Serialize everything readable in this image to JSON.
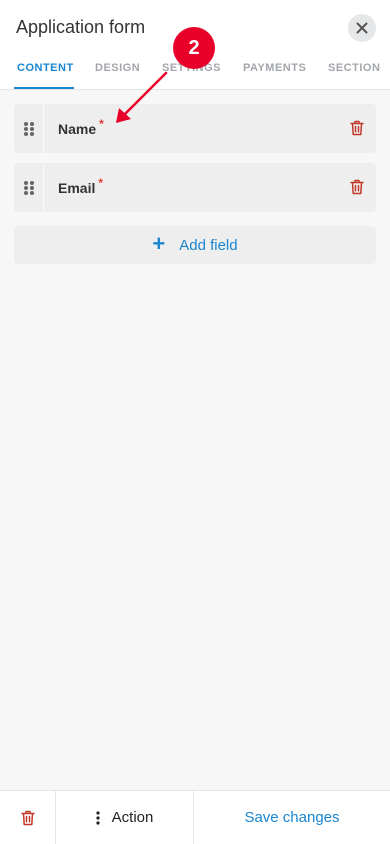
{
  "header": {
    "title": "Application form",
    "close_icon": "close-icon"
  },
  "tabs": [
    {
      "label": "CONTENT",
      "active": true
    },
    {
      "label": "DESIGN",
      "active": false
    },
    {
      "label": "SETTINGS",
      "active": false
    },
    {
      "label": "PAYMENTS",
      "active": false
    },
    {
      "label": "SECTION",
      "active": false
    }
  ],
  "fields": [
    {
      "label": "Name",
      "required": "*"
    },
    {
      "label": "Email",
      "required": "*"
    }
  ],
  "add_field": {
    "icon": "plus-icon",
    "label": "Add field"
  },
  "footer": {
    "delete_icon": "trash-icon",
    "action_label": "Action",
    "save_label": "Save changes"
  },
  "annotation": {
    "number": "2"
  },
  "colors": {
    "accent": "#1a86d0",
    "danger": "#c0392b",
    "required": "#e53935",
    "annotation": "#e8002b"
  }
}
